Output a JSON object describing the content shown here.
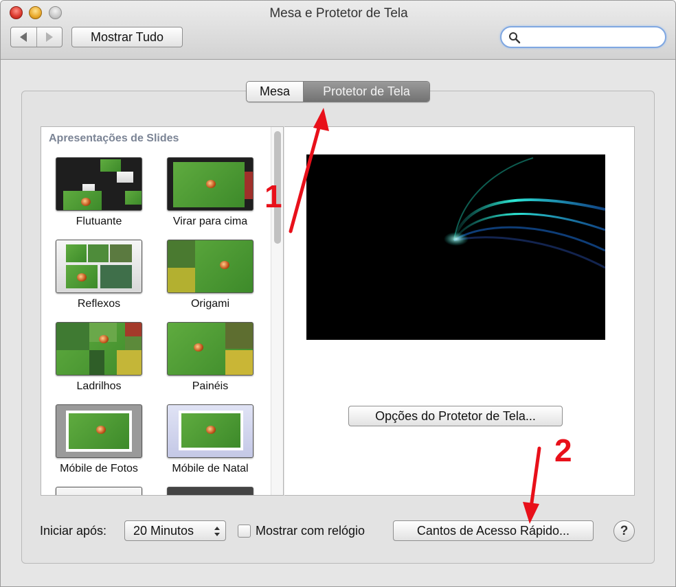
{
  "window": {
    "title": "Mesa e Protetor de Tela",
    "show_all": "Mostrar Tudo",
    "search_placeholder": ""
  },
  "tabs": [
    {
      "label": "Mesa",
      "selected": false
    },
    {
      "label": "Protetor de Tela",
      "selected": true
    }
  ],
  "list": {
    "header": "Apresentações de Slides",
    "items": [
      {
        "label": "Flutuante",
        "icon": "floating-photos-thumb"
      },
      {
        "label": "Virar para cima",
        "icon": "flip-up-thumb"
      },
      {
        "label": "Reflexos",
        "icon": "reflections-thumb"
      },
      {
        "label": "Origami",
        "icon": "origami-thumb"
      },
      {
        "label": "Ladrilhos",
        "icon": "tiles-thumb"
      },
      {
        "label": "Painéis",
        "icon": "panels-thumb"
      },
      {
        "label": "Móbile de Fotos",
        "icon": "photo-mobile-thumb"
      },
      {
        "label": "Móbile de Natal",
        "icon": "holiday-mobile-thumb"
      }
    ]
  },
  "preview": {
    "options_button": "Opções do Protetor de Tela..."
  },
  "bottom": {
    "start_label": "Iniciar após:",
    "start_value": "20 Minutos",
    "clock_label": "Mostrar com relógio",
    "clock_checked": false,
    "corners_button": "Cantos de Acesso Rápido...",
    "help": "?"
  },
  "annotations": {
    "one": "1",
    "two": "2",
    "color": "#e8101a"
  }
}
